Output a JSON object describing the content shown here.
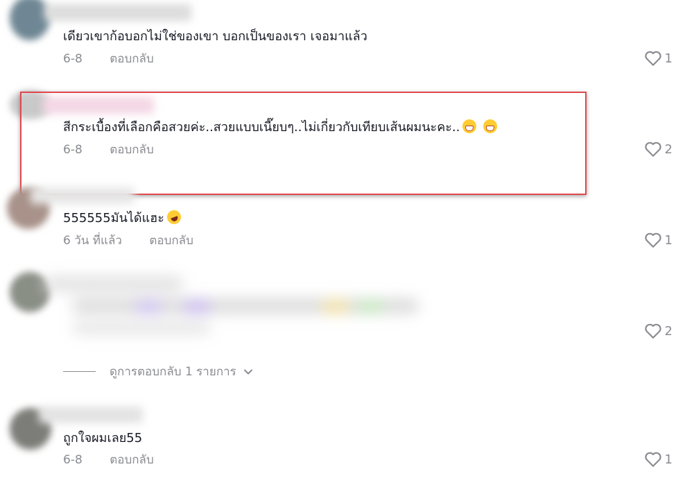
{
  "comments": [
    {
      "text": "เดียวเขาก้อบอกไม่ใช่ของเขา บอกเป็นของเรา เจอมาแล้ว",
      "date": "6-8",
      "reply_label": "ตอบกลับ",
      "likes": "1"
    },
    {
      "text": "สีกระเบื้องที่เลือกคือสวยค่ะ..สวยแบบเนี๊ยบๆ..ไม่เกี่ยวกับเทียบเส้นผมนะคะ..",
      "date": "6-8",
      "reply_label": "ตอบกลับ",
      "likes": "2",
      "emojis": [
        "grinning-face-emoji",
        "grinning-face-emoji"
      ]
    },
    {
      "text": "555555มันได้แฮะ",
      "date": "6 วัน ที่แล้ว",
      "reply_label": "ตอบกลับ",
      "likes": "1",
      "emojis": [
        "rolling-laughing-emoji"
      ]
    },
    {
      "likes": "2"
    },
    {
      "text": "ถูกใจผมเลย55",
      "date": "6-8",
      "reply_label": "ตอบกลับ",
      "likes": "1"
    }
  ],
  "view_replies": {
    "label": "ดูการตอบกลับ 1 รายการ"
  },
  "colors": {
    "text": "#161823",
    "meta": "#8a8b91",
    "highlight_border": "#e0474c"
  },
  "icons": {
    "like": "heart-outline-icon",
    "expand": "chevron-down-icon"
  }
}
